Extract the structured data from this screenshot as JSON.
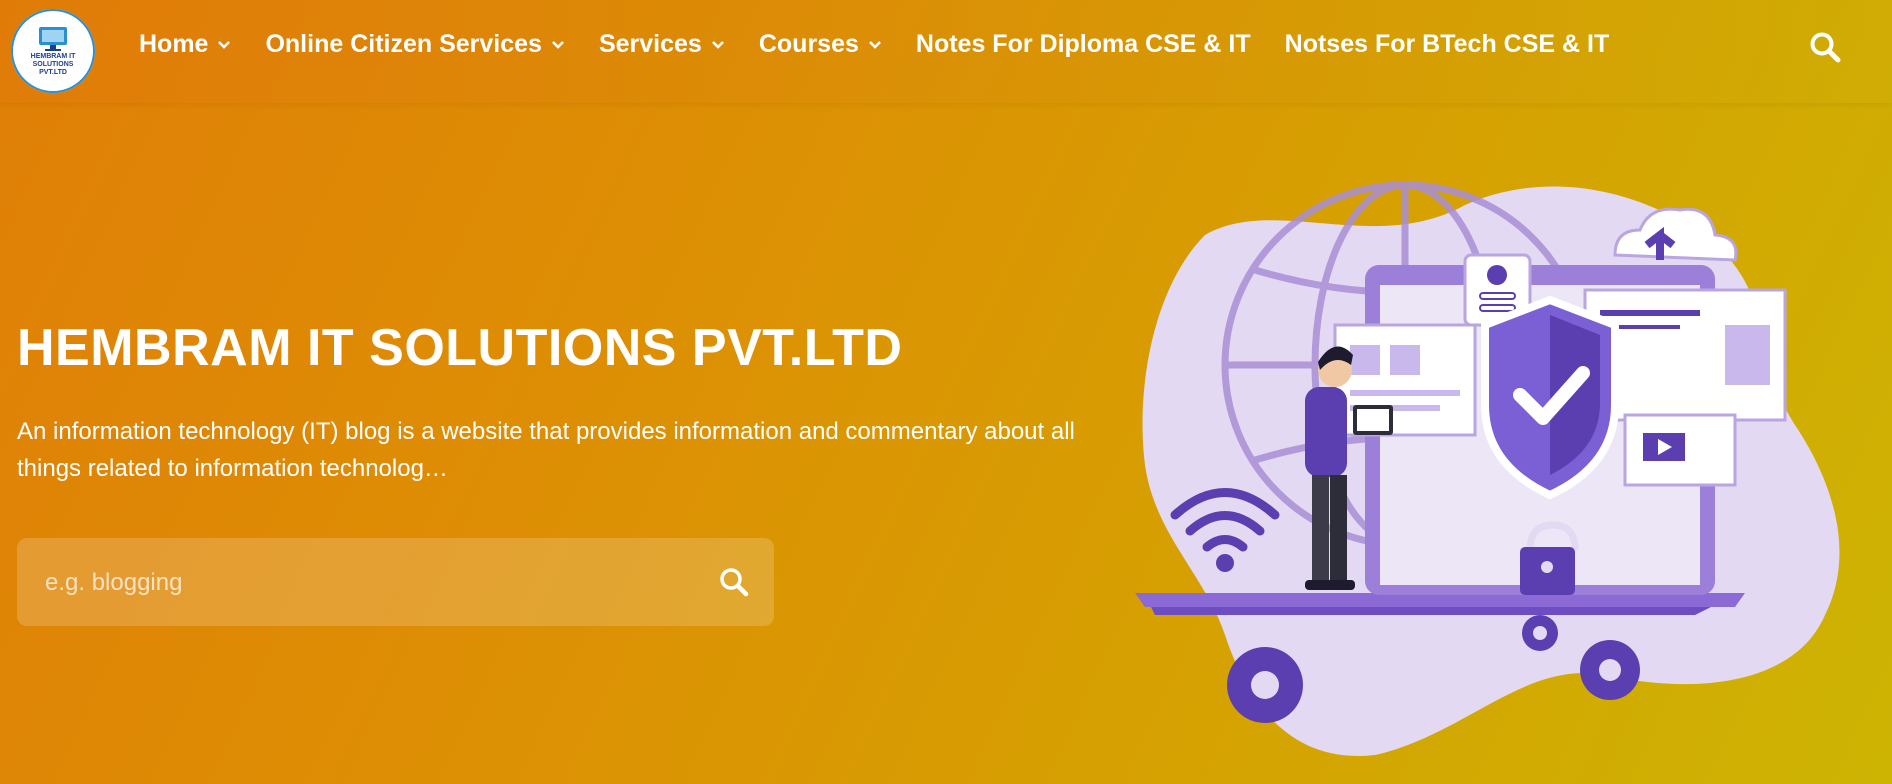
{
  "header": {
    "logo_alt": "HEMBRAM IT SOLUTIONS PVT.LTD",
    "logo_text": "HEMBRAM IT SOLUTIONS\nPVT.LTD",
    "nav": [
      {
        "label": "Home",
        "has_dropdown": true
      },
      {
        "label": "Online Citizen Services",
        "has_dropdown": true
      },
      {
        "label": "Services",
        "has_dropdown": true
      },
      {
        "label": "Courses",
        "has_dropdown": true
      },
      {
        "label": "Notes For Diploma CSE & IT",
        "has_dropdown": false
      },
      {
        "label": "Notses For BTech CSE & IT",
        "has_dropdown": false
      }
    ],
    "search_icon": "search-icon"
  },
  "hero": {
    "title": "HEMBRAM IT SOLUTIONS PVT.LTD",
    "description": "An information technology (IT) blog is a website that provides information and commentary about all things related to information technolog…",
    "search": {
      "placeholder": "e.g. blogging",
      "value": "",
      "button_icon": "search-icon"
    },
    "illustration": "cybersecurity-laptop-illustration"
  },
  "colors": {
    "background_start": "#e07f07",
    "background_end": "#cdb403",
    "illustration_primary": "#5b3fb0",
    "illustration_light": "#e4d9f2"
  }
}
